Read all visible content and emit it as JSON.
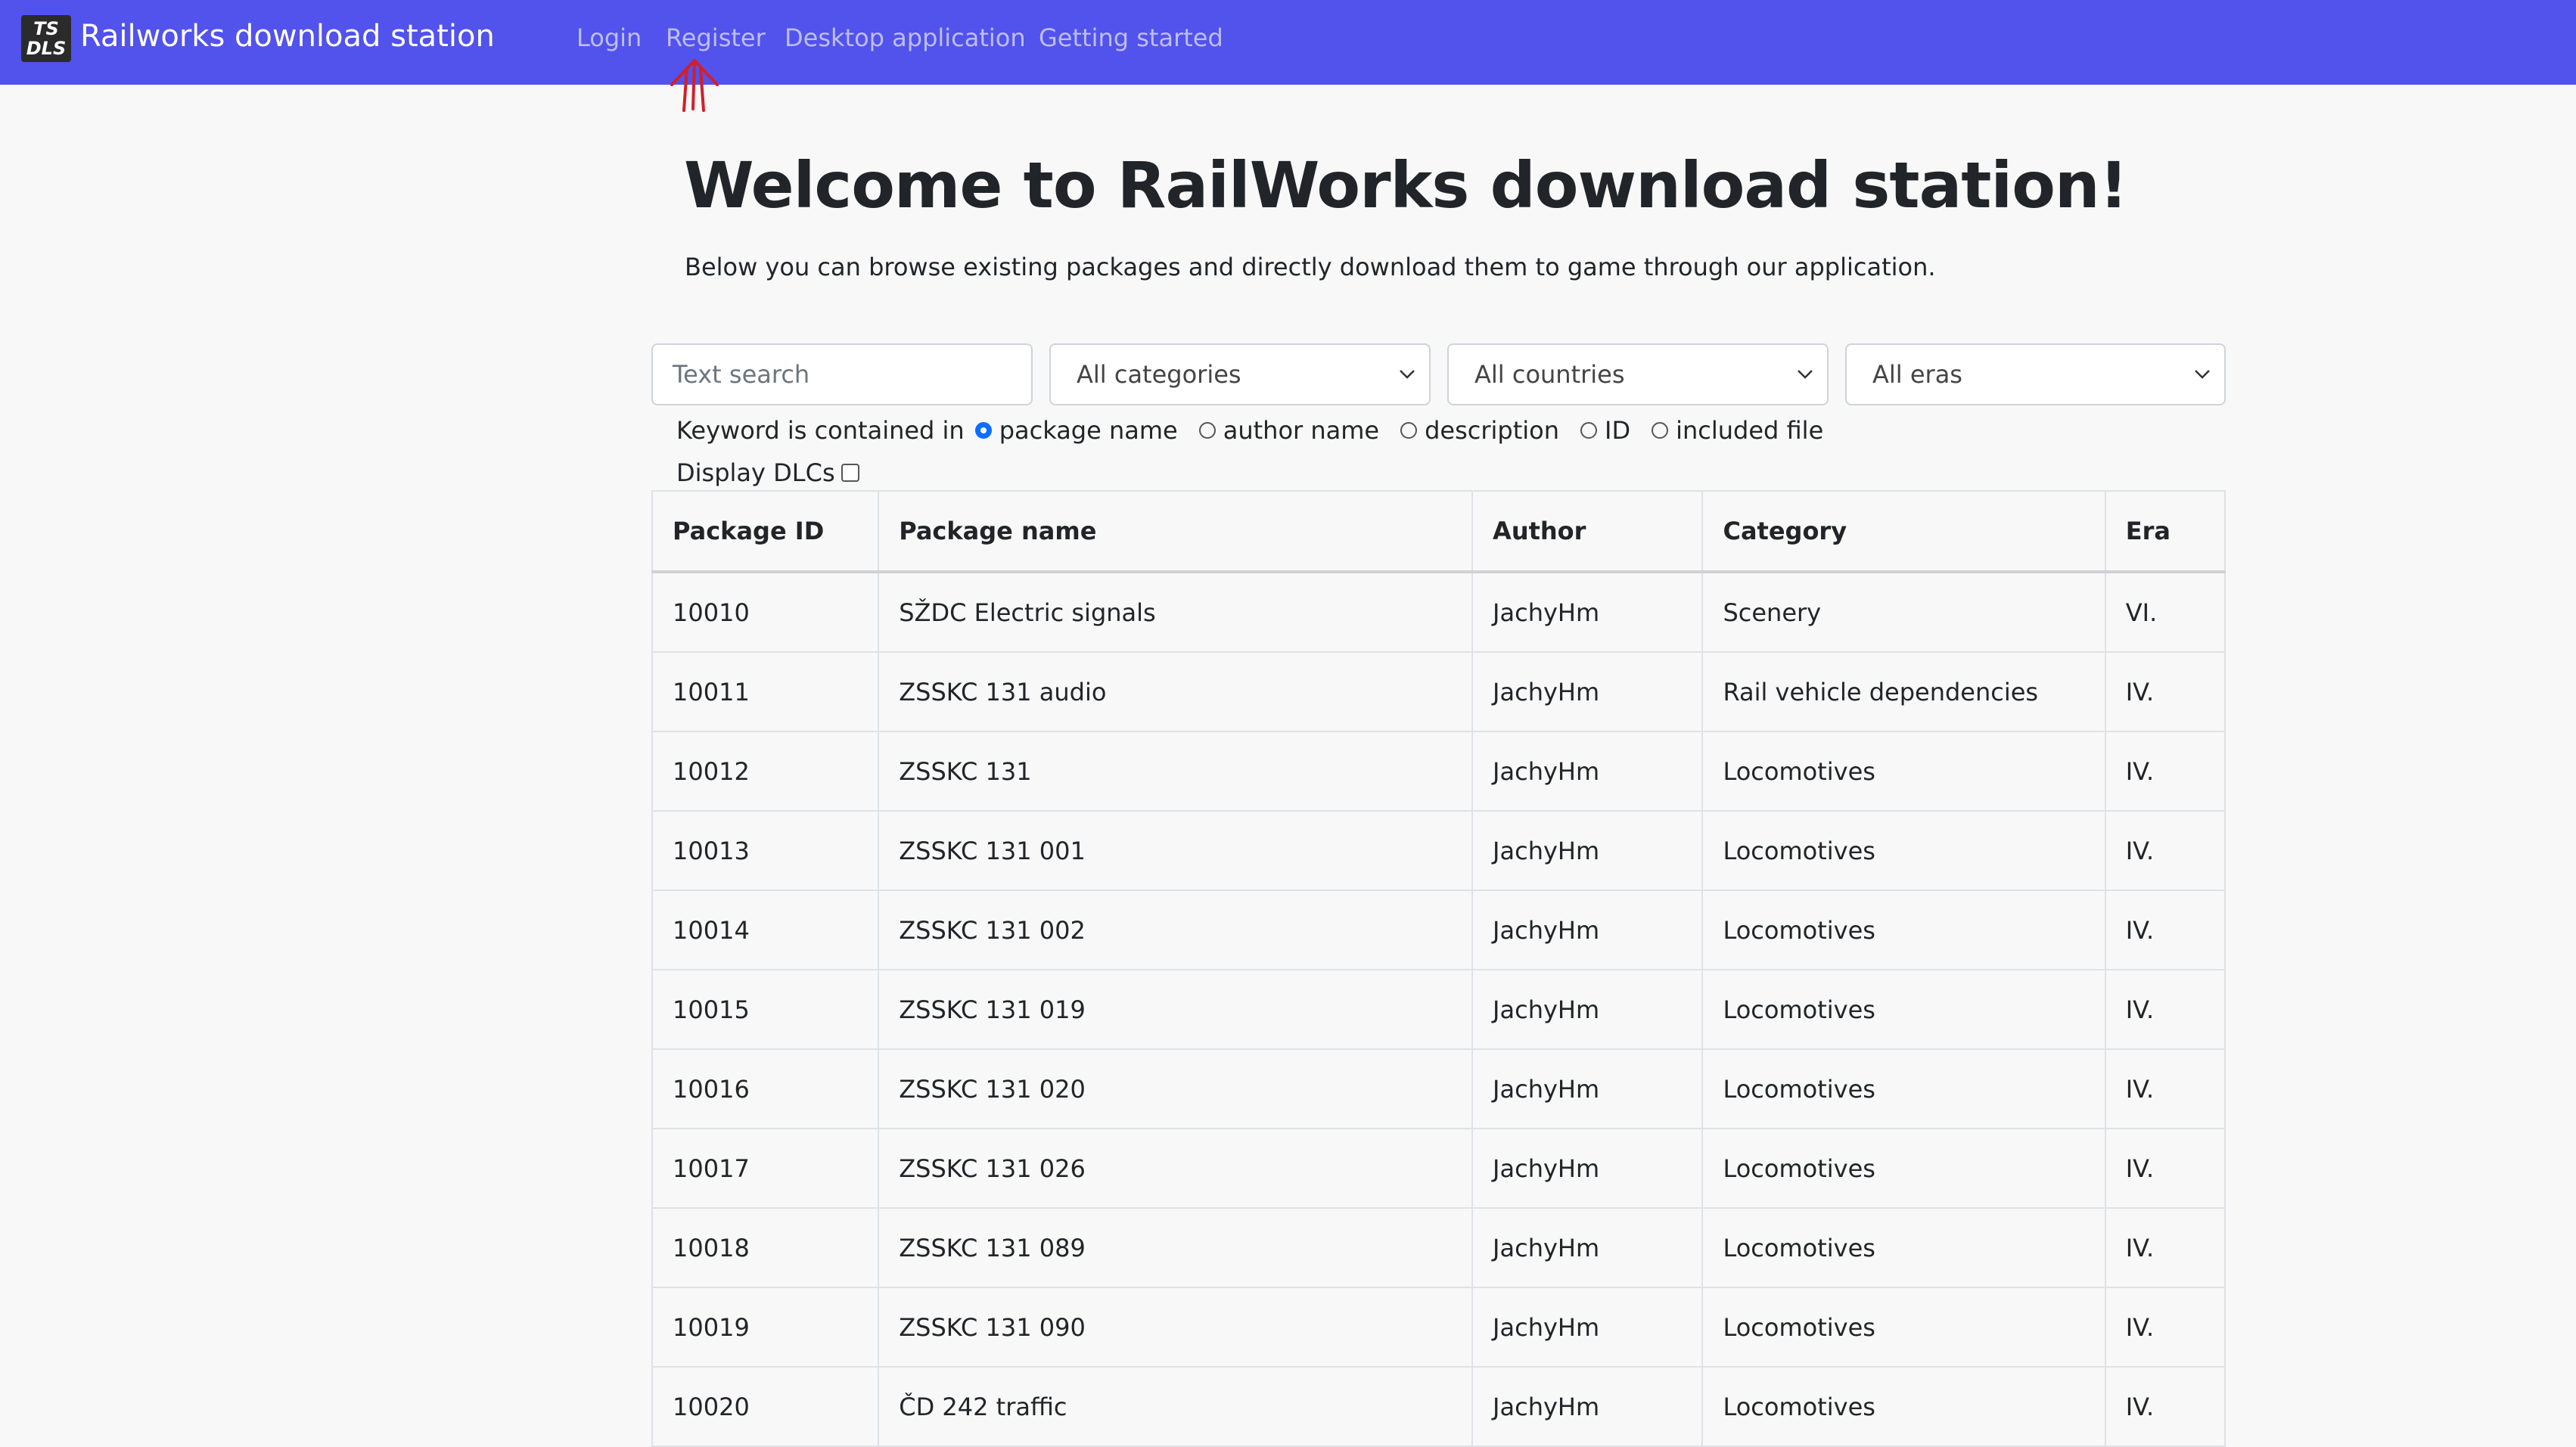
{
  "navbar": {
    "logo_line1": "TS",
    "logo_line2": "DLS",
    "brand": "Railworks download station",
    "links": [
      "Login",
      "Register",
      "Desktop application",
      "Getting started"
    ],
    "color": "#5252ec"
  },
  "hero": {
    "title": "Welcome to RailWorks download station!",
    "subtitle": "Below you can browse existing packages and directly download them to game through our application."
  },
  "filters": {
    "search_placeholder": "Text search",
    "category": "All categories",
    "country": "All countries",
    "era": "All eras",
    "keyword_label": "Keyword is contained in",
    "keyword_options": [
      "package name",
      "author name",
      "description",
      "ID",
      "included file"
    ],
    "keyword_selected": "package name",
    "dlc_label": "Display DLCs",
    "dlc_checked": false
  },
  "table": {
    "headers": [
      "Package ID",
      "Package name",
      "Author",
      "Category",
      "Era"
    ],
    "rows": [
      [
        "10010",
        "SŽDC Electric signals",
        "JachyHm",
        "Scenery",
        "VI."
      ],
      [
        "10011",
        "ZSSKC 131 audio",
        "JachyHm",
        "Rail vehicle dependencies",
        "IV."
      ],
      [
        "10012",
        "ZSSKC 131",
        "JachyHm",
        "Locomotives",
        "IV."
      ],
      [
        "10013",
        "ZSSKC 131 001",
        "JachyHm",
        "Locomotives",
        "IV."
      ],
      [
        "10014",
        "ZSSKC 131 002",
        "JachyHm",
        "Locomotives",
        "IV."
      ],
      [
        "10015",
        "ZSSKC 131 019",
        "JachyHm",
        "Locomotives",
        "IV."
      ],
      [
        "10016",
        "ZSSKC 131 020",
        "JachyHm",
        "Locomotives",
        "IV."
      ],
      [
        "10017",
        "ZSSKC 131 026",
        "JachyHm",
        "Locomotives",
        "IV."
      ],
      [
        "10018",
        "ZSSKC 131 089",
        "JachyHm",
        "Locomotives",
        "IV."
      ],
      [
        "10019",
        "ZSSKC 131 090",
        "JachyHm",
        "Locomotives",
        "IV."
      ],
      [
        "10020",
        "ČD 242 traffic",
        "JachyHm",
        "Locomotives",
        "IV."
      ]
    ]
  }
}
